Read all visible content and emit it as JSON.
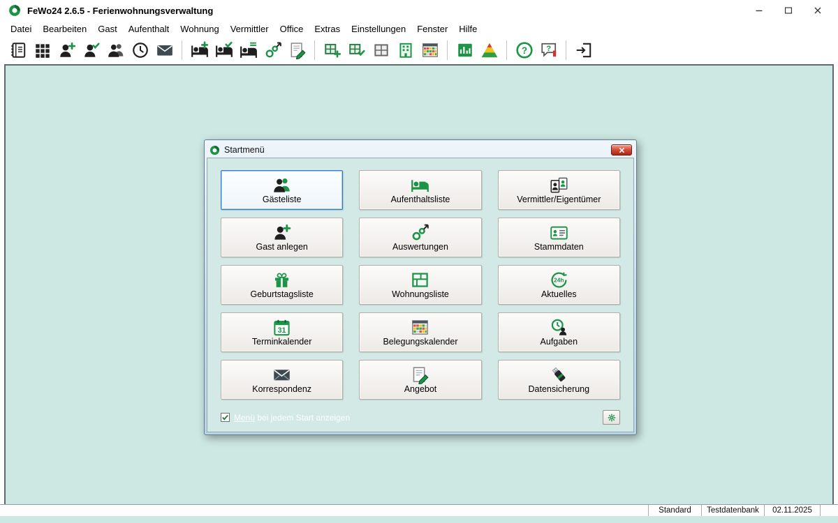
{
  "window": {
    "title": "FeWo24 2.6.5  -  Ferienwohnungsverwaltung"
  },
  "menubar": {
    "items": [
      "Datei",
      "Bearbeiten",
      "Gast",
      "Aufenthalt",
      "Wohnung",
      "Vermittler",
      "Office",
      "Extras",
      "Einstellungen",
      "Fenster",
      "Hilfe"
    ]
  },
  "toolbar": {
    "icons": [
      "phonebook-icon",
      "grid-overview-icon",
      "guest-add-icon",
      "guest-check-icon",
      "guest-list-icon",
      "clock-icon",
      "mail-icon",
      "stay-add-icon",
      "stay-check-icon",
      "stay-list-icon",
      "analytics-icon",
      "offer-edit-icon",
      "apartment-add-icon",
      "apartment-check-icon",
      "apartment-list-icon",
      "building-icon",
      "occupancy-calendar-icon",
      "report-chart-icon",
      "priority-pyramid-icon",
      "help-icon",
      "feedback-icon",
      "exit-icon"
    ],
    "help_glyph": "?",
    "feedback_glyph": "?"
  },
  "dialog": {
    "title": "Startmenü",
    "buttons": [
      {
        "label": "Gästeliste",
        "icon": "guest-list-icon",
        "selected": true
      },
      {
        "label": "Aufenthaltsliste",
        "icon": "bed-icon"
      },
      {
        "label": "Vermittler/Eigentümer",
        "icon": "id-cards-icon"
      },
      {
        "label": "Gast anlegen",
        "icon": "person-add-icon"
      },
      {
        "label": "Auswertungen",
        "icon": "analytics-icon"
      },
      {
        "label": "Stammdaten",
        "icon": "masterdata-card-icon"
      },
      {
        "label": "Geburtstagsliste",
        "icon": "gift-icon"
      },
      {
        "label": "Wohnungsliste",
        "icon": "floorplan-icon"
      },
      {
        "label": "Aktuelles",
        "icon": "24h-service-icon",
        "icon_text": "24h"
      },
      {
        "label": "Terminkalender",
        "icon": "calendar-31-icon",
        "icon_text": "31"
      },
      {
        "label": "Belegungskalender",
        "icon": "occupancy-calendar-icon"
      },
      {
        "label": "Aufgaben",
        "icon": "person-clock-icon"
      },
      {
        "label": "Korrespondenz",
        "icon": "envelope-icon"
      },
      {
        "label": "Angebot",
        "icon": "document-pencil-icon"
      },
      {
        "label": "Datensicherung",
        "icon": "usb-stick-icon"
      }
    ],
    "footer": {
      "checkbox_checked": true,
      "checkbox_label_underlined": "Menü",
      "checkbox_label_rest": " bei jedem Start anzeigen"
    }
  },
  "statusbar": {
    "profile": "Standard",
    "database": "Testdatenbank",
    "date": "02.11.2025"
  },
  "colors": {
    "brand_green": "#1d9348",
    "teal_background": "#cde7e3",
    "selection_blue": "#2f78c8",
    "close_red": "#d6503c"
  }
}
